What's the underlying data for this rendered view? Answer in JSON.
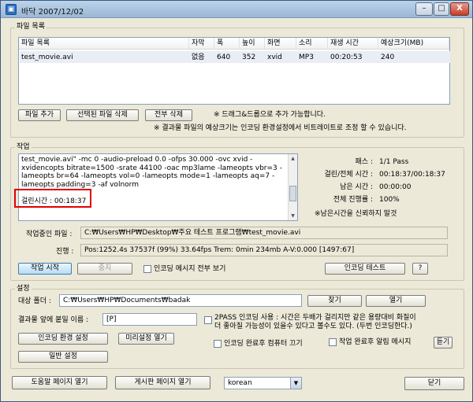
{
  "window": {
    "title": "바닥 2007/12/02",
    "min_label": "–",
    "max_label": "□",
    "close_label": "X"
  },
  "file_section": {
    "label": "파일 목록",
    "columns": [
      "파일 목록",
      "자막",
      "폭",
      "높이",
      "화면",
      "소리",
      "재생 시간",
      "예상크기(MB)"
    ],
    "rows": [
      [
        "test_movie.avi",
        "없음",
        "640",
        "352",
        "xvid",
        "MP3",
        "00:20:53",
        "240"
      ]
    ],
    "add_file": "파일 추가",
    "delete_selected": "선택된 파일 삭제",
    "delete_all": "전부 삭제",
    "drag_hint": "※ 드래그&드롭으로 추가 가능합니다.",
    "size_hint": "※ 결과물 파일의 예상크기는 인코딩 환경설정에서 비트레이트로 조정 할 수 있습니다."
  },
  "work_section": {
    "label": "작업",
    "log_lines": [
      "test_movie.avi\" -mc 0 -audio-preload 0.0 -ofps 30.000 -ovc xvid -",
      "xvidencopts bitrate=1500 -srate 44100 -oac mp3lame -lameopts vbr=3 -",
      "lameopts br=64 -lameopts vol=0 -lameopts mode=1 -lameopts aq=7 -",
      "lameopts padding=3 -af volnorm",
      "",
      "걸린시간 : 00:18:37"
    ],
    "stats": [
      {
        "label": "패스 :",
        "value": "1/1 Pass"
      },
      {
        "label": "걸린/전체 시간 :",
        "value": "00:18:37/00:18:37"
      },
      {
        "label": "남은 시간 :",
        "value": "00:00:00"
      },
      {
        "label": "전체 진행률 :",
        "value": "100%"
      }
    ],
    "remaining_note": "※남은시간을 신뢰하지 말것",
    "current_file_label": "작업중인 파일 :",
    "current_file_value": "C:₩Users₩HP₩Desktop₩주요 테스트 프로그램₩test_movie.avi",
    "progress_label": "진행 :",
    "progress_value": "Pos:1252.4s  37537f (99%) 33.64fps Trem:    0min 234mb  A-V:0.000 [1497:67]",
    "start_button": "작업 시작",
    "stop_button": "중지",
    "show_all_messages": "인코딩 메시지 전부 보기",
    "encode_test": "인코딩 테스트",
    "help_button": "?"
  },
  "settings_section": {
    "label": "설정",
    "target_folder_label": "대상 폴더 :",
    "target_folder_value": "C:₩Users₩HP₩Documents₩badak",
    "find_button": "찾기",
    "open_button": "열기",
    "prefix_label": "결과물 앞에 붙일 이름 :",
    "prefix_value": "[P]",
    "twopass_text_1": "2PASS 인코딩 사용 : 시간은 두배가 걸리지만 같은 용량대비 화질이",
    "twopass_text_2": "더 좋아질 가능성이 있을수 있다고 볼수도 있다. (두번 인코딩한다.)",
    "encode_settings_button": "인코딩 환경 설정",
    "preset_open_button": "미리설정 열기",
    "shutdown_label": "인코딩 완료후 컴퓨터 끄기",
    "notify_label": "작업 완료후 알림 메시지",
    "listen_button": "듣기",
    "general_settings_button": "일반 설정"
  },
  "footer": {
    "help_page": "도움말 페이지 열기",
    "board_page": "게시판 페이지 열기",
    "language": "korean",
    "close": "닫기"
  }
}
